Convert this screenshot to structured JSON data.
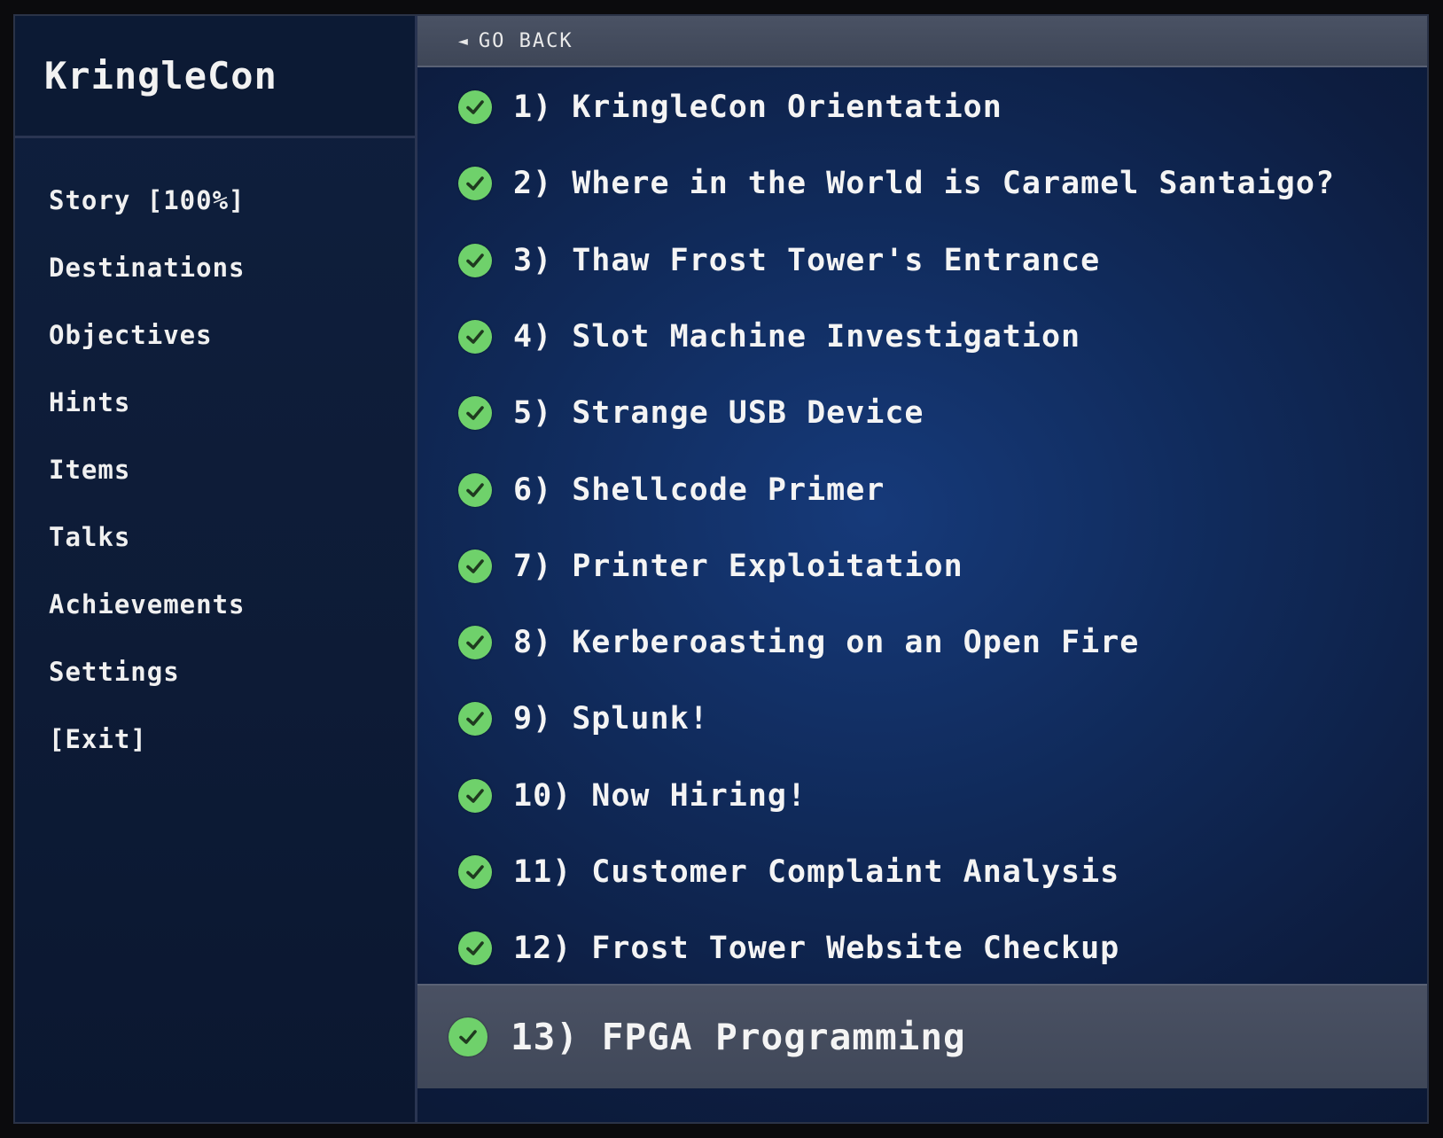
{
  "sidebar": {
    "title": "KringleCon",
    "items": [
      {
        "label": "Story [100%]",
        "name": "sidebar-item-story"
      },
      {
        "label": "Destinations",
        "name": "sidebar-item-destinations"
      },
      {
        "label": "Objectives",
        "name": "sidebar-item-objectives"
      },
      {
        "label": "Hints",
        "name": "sidebar-item-hints"
      },
      {
        "label": "Items",
        "name": "sidebar-item-items"
      },
      {
        "label": "Talks",
        "name": "sidebar-item-talks"
      },
      {
        "label": "Achievements",
        "name": "sidebar-item-achievements"
      },
      {
        "label": "Settings",
        "name": "sidebar-item-settings"
      },
      {
        "label": "[Exit]",
        "name": "sidebar-item-exit"
      }
    ]
  },
  "main": {
    "go_back": {
      "arrow": "◄",
      "label": "GO BACK"
    },
    "objectives": [
      {
        "label": "1) KringleCon Orientation",
        "completed": true
      },
      {
        "label": "2) Where in the World is Caramel Santaigo?",
        "completed": true
      },
      {
        "label": "3) Thaw Frost Tower's Entrance",
        "completed": true
      },
      {
        "label": "4) Slot Machine Investigation",
        "completed": true
      },
      {
        "label": "5) Strange USB Device",
        "completed": true
      },
      {
        "label": "6) Shellcode Primer",
        "completed": true
      },
      {
        "label": "7) Printer Exploitation",
        "completed": true
      },
      {
        "label": "8) Kerberoasting on an Open Fire",
        "completed": true
      },
      {
        "label": "9) Splunk!",
        "completed": true
      },
      {
        "label": "10) Now Hiring!",
        "completed": true
      },
      {
        "label": "11) Customer Complaint Analysis",
        "completed": true
      },
      {
        "label": "12) Frost Tower Website Checkup",
        "completed": true
      },
      {
        "label": "13) FPGA Programming",
        "completed": true,
        "selected": true
      }
    ]
  },
  "icons": {
    "check": "check-circle-icon",
    "back": "back-arrow-icon"
  },
  "colors": {
    "check_green": "#6fd16b",
    "accent_bar": "#454d5f",
    "panel_blue": "#102a5a"
  }
}
